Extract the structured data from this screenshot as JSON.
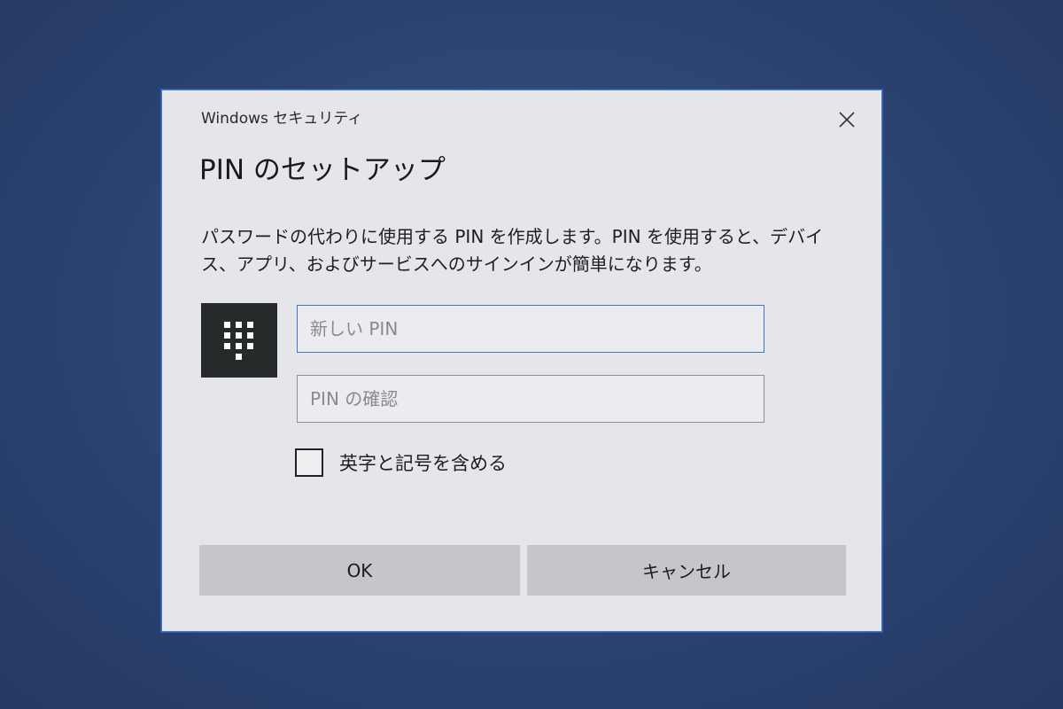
{
  "dialog": {
    "window_title": "Windows セキュリティ",
    "heading": "PIN のセットアップ",
    "description": "パスワードの代わりに使用する PIN を作成します。PIN を使用すると、デバイス、アプリ、およびサービスへのサインインが簡単になります。",
    "icons": {
      "close": "close-icon",
      "pin": "pin-keypad-icon"
    },
    "new_pin": {
      "placeholder": "新しい PIN",
      "value": ""
    },
    "confirm_pin": {
      "placeholder": "PIN の確認",
      "value": ""
    },
    "include_letters_symbols": {
      "label": "英字と記号を含める",
      "checked": false
    },
    "buttons": {
      "ok": "OK",
      "cancel": "キャンセル"
    }
  },
  "colors": {
    "desktop_background": "#2f4773",
    "dialog_background": "#e6e6ea",
    "accent_border": "#3d78c8",
    "button_background": "#c6c6ca",
    "icon_tile": "#262a2a"
  }
}
